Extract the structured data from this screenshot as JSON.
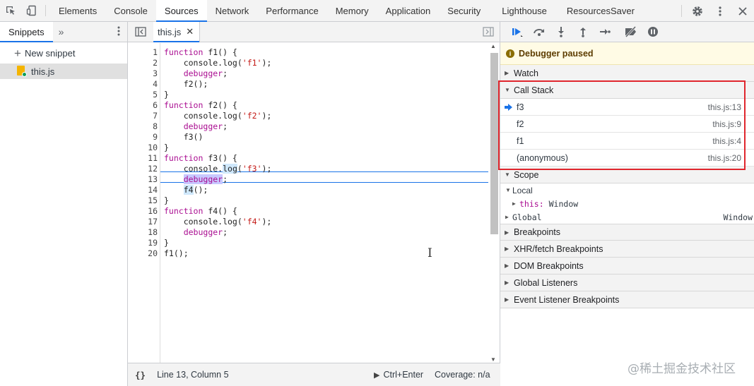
{
  "top_tabs": [
    "Elements",
    "Console",
    "Sources",
    "Network",
    "Performance",
    "Memory",
    "Application",
    "Security",
    "Lighthouse",
    "ResourcesSaver"
  ],
  "active_top_tab": "Sources",
  "navigator": {
    "tab": "Snippets",
    "more": "»",
    "new_snippet": "New snippet",
    "file": "this.js"
  },
  "editor": {
    "file_tab": "this.js",
    "status_position": "Line 13, Column 5",
    "run_shortcut": "Ctrl+Enter",
    "coverage": "Coverage: n/a",
    "braces": "{}",
    "current_line": 13
  },
  "debugger": {
    "paused_label": "Debugger paused",
    "sections": {
      "watch": "Watch",
      "call_stack": "Call Stack",
      "scope": "Scope",
      "breakpoints": "Breakpoints",
      "xhr": "XHR/fetch Breakpoints",
      "dom": "DOM Breakpoints",
      "global_listeners": "Global Listeners",
      "event_listeners": "Event Listener Breakpoints"
    },
    "call_stack": [
      {
        "name": "f3",
        "loc": "this.js:13"
      },
      {
        "name": "f2",
        "loc": "this.js:9"
      },
      {
        "name": "f1",
        "loc": "this.js:4"
      },
      {
        "name": "(anonymous)",
        "loc": "this.js:20"
      }
    ],
    "scope": {
      "local": "Local",
      "this_key": "this:",
      "this_val": "Window",
      "global": "Global",
      "global_val": "Window"
    }
  },
  "watermark": "@稀土掘金技术社区",
  "colors": {
    "accent": "#1a73e8",
    "highlight_box": "#e0262d",
    "keyword": "#aa0d91",
    "string": "#c41a16"
  }
}
